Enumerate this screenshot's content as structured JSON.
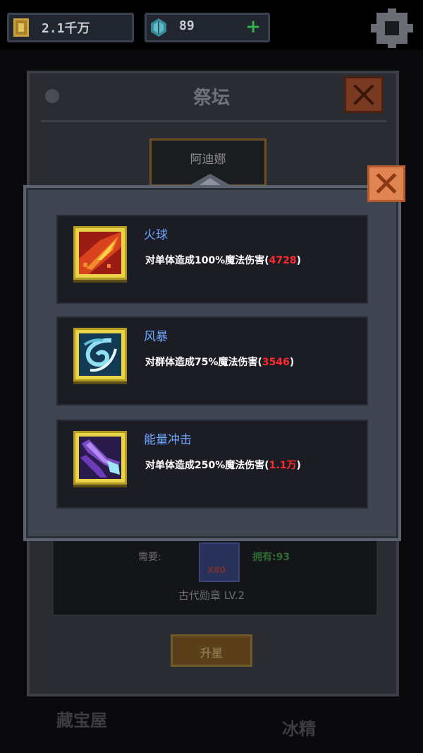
{
  "resources": {
    "gold": {
      "amount": "2.1千万",
      "icon": "gold-coin-icon"
    },
    "gems": {
      "amount": "89",
      "icon": "gem-icon",
      "add_label": "+"
    }
  },
  "settings_icon": "gear-icon",
  "altar": {
    "title": "祭坛",
    "hero_name": "阿迪娜",
    "need_label": "需要:",
    "medal_count": "X80",
    "owned_label": "拥有:93",
    "medal_name": "古代勋章 LV.2",
    "upgrade_label": "升星",
    "bottom_left": "藏宝屋",
    "bottom_right": "冰精"
  },
  "popup": {
    "skills": [
      {
        "name": "火球",
        "desc_prefix": "对单体造成100%魔法伤害(",
        "damage": "4728",
        "desc_suffix": ")",
        "icon": "fireball-icon",
        "color": "#d8421c"
      },
      {
        "name": "风暴",
        "desc_prefix": "对群体造成75%魔法伤害(",
        "damage": "3546",
        "desc_suffix": ")",
        "icon": "storm-icon",
        "color": "#6fc8e8"
      },
      {
        "name": "能量冲击",
        "desc_prefix": "对单体造成250%魔法伤害(",
        "damage": "1.1万",
        "desc_suffix": ")",
        "icon": "energy-impact-icon",
        "color": "#8a5ad8"
      }
    ]
  }
}
